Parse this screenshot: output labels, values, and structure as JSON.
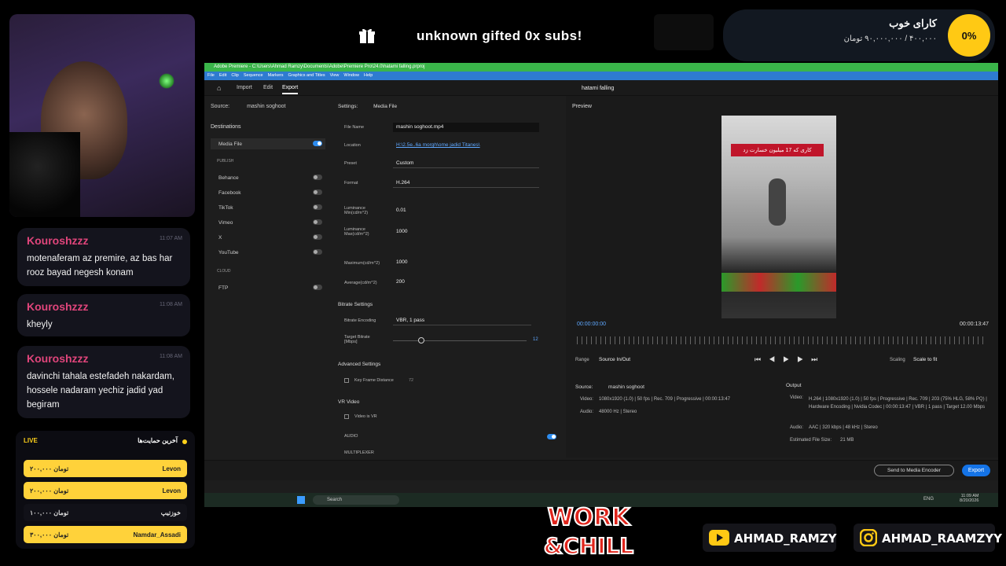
{
  "chat": [
    {
      "user": "Kouroshzzz",
      "time": "11:07 AM",
      "text": "motenaferam az premire, az bas har rooz bayad negesh konam"
    },
    {
      "user": "Kouroshzzz",
      "time": "11:08 AM",
      "text": "kheyly"
    },
    {
      "user": "Kouroshzzz",
      "time": "11:08 AM",
      "text": "davinchi tahala estefadeh nakardam, hossele nadaram yechiz jadid yad begiram"
    }
  ],
  "supports": {
    "live": "LIVE",
    "title": "آخرین حمایت‌ها",
    "rows": [
      {
        "name": "Levon",
        "amount": "۲۰۰,۰۰۰ تومان",
        "style": "y"
      },
      {
        "name": "Levon",
        "amount": "۲۰۰,۰۰۰ تومان",
        "style": "y"
      },
      {
        "name": "خوزتیپ",
        "amount": "۱۰۰,۰۰۰ تومان",
        "style": "d"
      },
      {
        "name": "Namdar_Assadi",
        "amount": "۳۰۰,۰۰۰ تومان",
        "style": "y"
      }
    ]
  },
  "gift": {
    "text": "unknown gifted 0x subs!"
  },
  "goal": {
    "title": "کارای خوب",
    "amount": "۴۰۰,۰۰۰ / ۹۰,۰۰۰,۰۰۰ تومان",
    "percent": "0%"
  },
  "app": {
    "title": "Adobe Premiere - C:\\Users\\Ahmad Ramzy\\Documents\\Adobe\\Premiere Pro\\24.0\\hatami falling.prproj",
    "menu": [
      "File",
      "Edit",
      "Clip",
      "Sequence",
      "Markers",
      "Graphics and Titles",
      "View",
      "Window",
      "Help"
    ],
    "tabs": {
      "import": "Import",
      "edit": "Edit",
      "export": "Export"
    },
    "doc_title": "hatami falling",
    "source_label": "Source:",
    "source_name": "mashin soghoot",
    "destinations": "Destinations",
    "media_file": "Media File",
    "publish": "PUBLISH",
    "cloud": "CLOUD",
    "publish_items": [
      "Behance",
      "Facebook",
      "TikTok",
      "Vimeo",
      "X",
      "YouTube"
    ],
    "ftp": "FTP",
    "settings": {
      "header": "Settings:",
      "header_val": "Media File",
      "file_name_lbl": "File Name",
      "file_name": "mashin soghoot.mp4",
      "location_lbl": "Location",
      "location": "H:\\2.5e..6a morgh\\ome jadid Titanes\\",
      "preset_lbl": "Preset",
      "preset": "Custom",
      "format_lbl": "Format",
      "format": "H.264",
      "lum_min_lbl": "Luminance Min(cd/m^2)",
      "lum_min": "0.01",
      "lum_max_lbl": "Luminance Max(cd/m^2)",
      "lum_max": "1000",
      "maximum_lbl": "Maximum(cd/m^2)",
      "maximum": "1000",
      "average_lbl": "Average(cd/m^2)",
      "average": "200",
      "bitrate_settings": "Bitrate Settings",
      "bitrate_enc_lbl": "Bitrate Encoding",
      "bitrate_enc": "VBR, 1 pass",
      "target_lbl": "Target Bitrate [Mbps]",
      "target": "12",
      "advanced": "Advanced Settings",
      "keyframe_lbl": "Key Frame Distance",
      "keyframe": "72",
      "vr": "VR Video",
      "vr_item": "Video is VR",
      "audio": "AUDIO",
      "multiplexer": "MULTIPLEXER"
    },
    "preview": {
      "label": "Preview",
      "overlay": "کاری که 17 میلیون خسارت زد",
      "time_start": "00:00:00:00",
      "time_end": "00:00:13:47",
      "range_lbl": "Range",
      "range": "Source In/Out",
      "scaling_lbl": "Scaling",
      "scaling": "Scale to fit"
    },
    "source_info": {
      "label": "Source:",
      "name": "mashin soghoot",
      "video_lbl": "Video:",
      "video": "1080x1920 (1.0) | 50 fps | Rec. 709 | Progressive | 00:00:13:47",
      "audio_lbl": "Audio:",
      "audio": "48000 Hz | Stereo"
    },
    "output_info": {
      "label": "Output",
      "video_lbl": "Video:",
      "video": "H.264 | 1080x1920 (1.0) | 50 fps | Progressive | Rec. 709 | 203 (75% HLG, 58% PQ) | Hardware Encoding | Nvidia Codec | 00:00:13:47 | VBR | 1 pass | Target 12.00 Mbps",
      "audio_lbl": "Audio:",
      "audio": "AAC | 320 kbps | 48 kHz | Stereo",
      "size_lbl": "Estimated File Size:",
      "size": "21 MB"
    },
    "send_encoder": "Send to Media Encoder",
    "export_btn": "Export"
  },
  "taskbar": {
    "search": "Search",
    "lang": "ENG",
    "time": "11:09 AM",
    "date": "8/20/2026"
  },
  "social": {
    "youtube": "AHMAD_RAMZY",
    "instagram": "AHMAD_RAAMZYY"
  },
  "logo": {
    "line1": "WORK",
    "line2": "&CHILL"
  }
}
